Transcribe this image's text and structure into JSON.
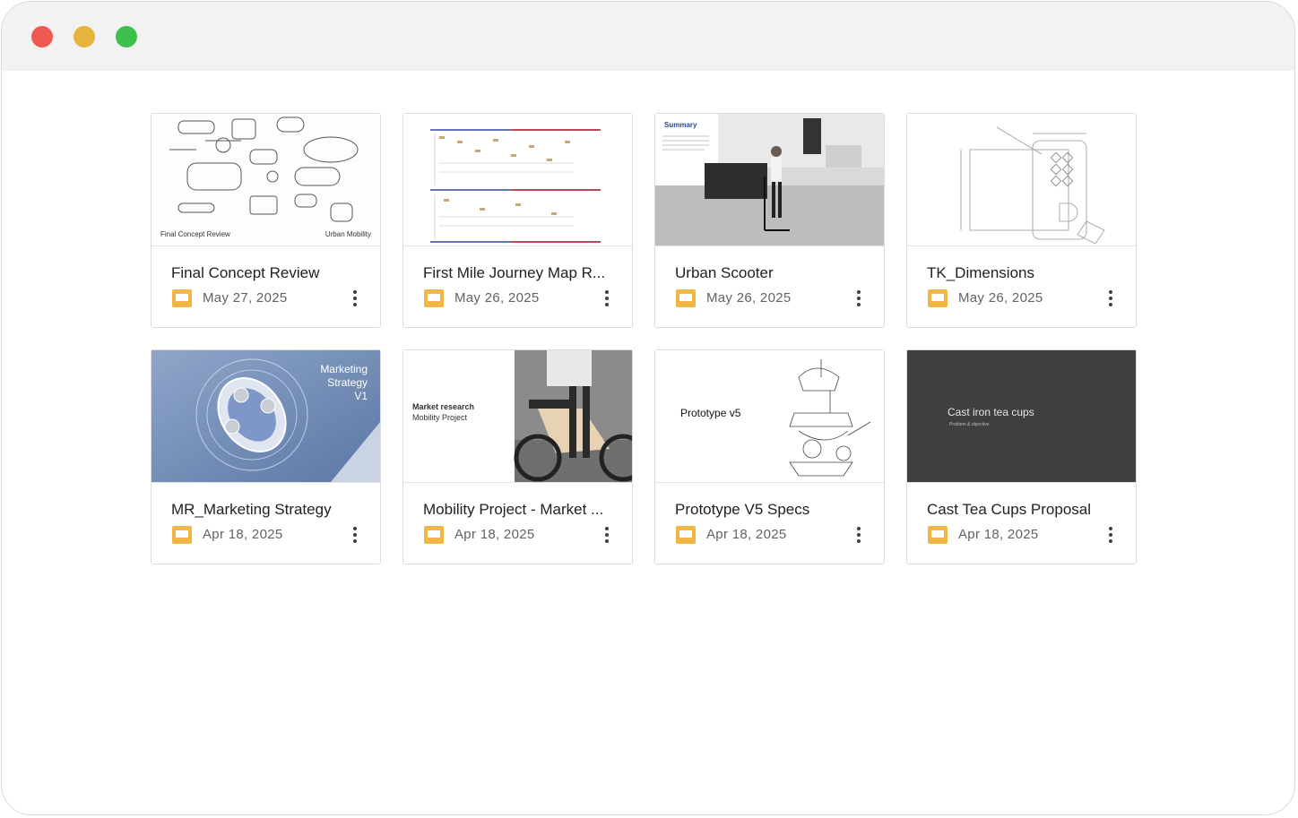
{
  "window": {
    "controls": [
      "close",
      "minimize",
      "maximize"
    ]
  },
  "files": [
    {
      "title": "Final Concept Review",
      "date": "May 27, 2025",
      "thumb_left": "Final Concept Review",
      "thumb_right": "Urban Mobility"
    },
    {
      "title": "First Mile Journey Map R...",
      "date": "May 26, 2025"
    },
    {
      "title": "Urban Scooter",
      "date": "May 26, 2025",
      "thumb_heading": "Summary"
    },
    {
      "title": "TK_Dimensions",
      "date": "May 26, 2025"
    },
    {
      "title": "MR_Marketing Strategy",
      "date": "Apr 18, 2025",
      "thumb_text": [
        "Marketing",
        "Strategy",
        "V1"
      ]
    },
    {
      "title": "Mobility Project - Market ...",
      "date": "Apr 18, 2025",
      "thumb_heading": "Market research",
      "thumb_sub": "Mobility Project"
    },
    {
      "title": "Prototype V5 Specs",
      "date": "Apr 18, 2025",
      "thumb_heading": "Prototype v5"
    },
    {
      "title": "Cast Tea Cups Proposal",
      "date": "Apr 18, 2025",
      "thumb_heading": "Cast iron tea cups",
      "thumb_sub": "Problem & objective"
    }
  ],
  "colors": {
    "slides_icon": "#f1b644",
    "close": "#ee5a52",
    "minimize": "#e6b33c",
    "maximize": "#3fbf4c"
  }
}
